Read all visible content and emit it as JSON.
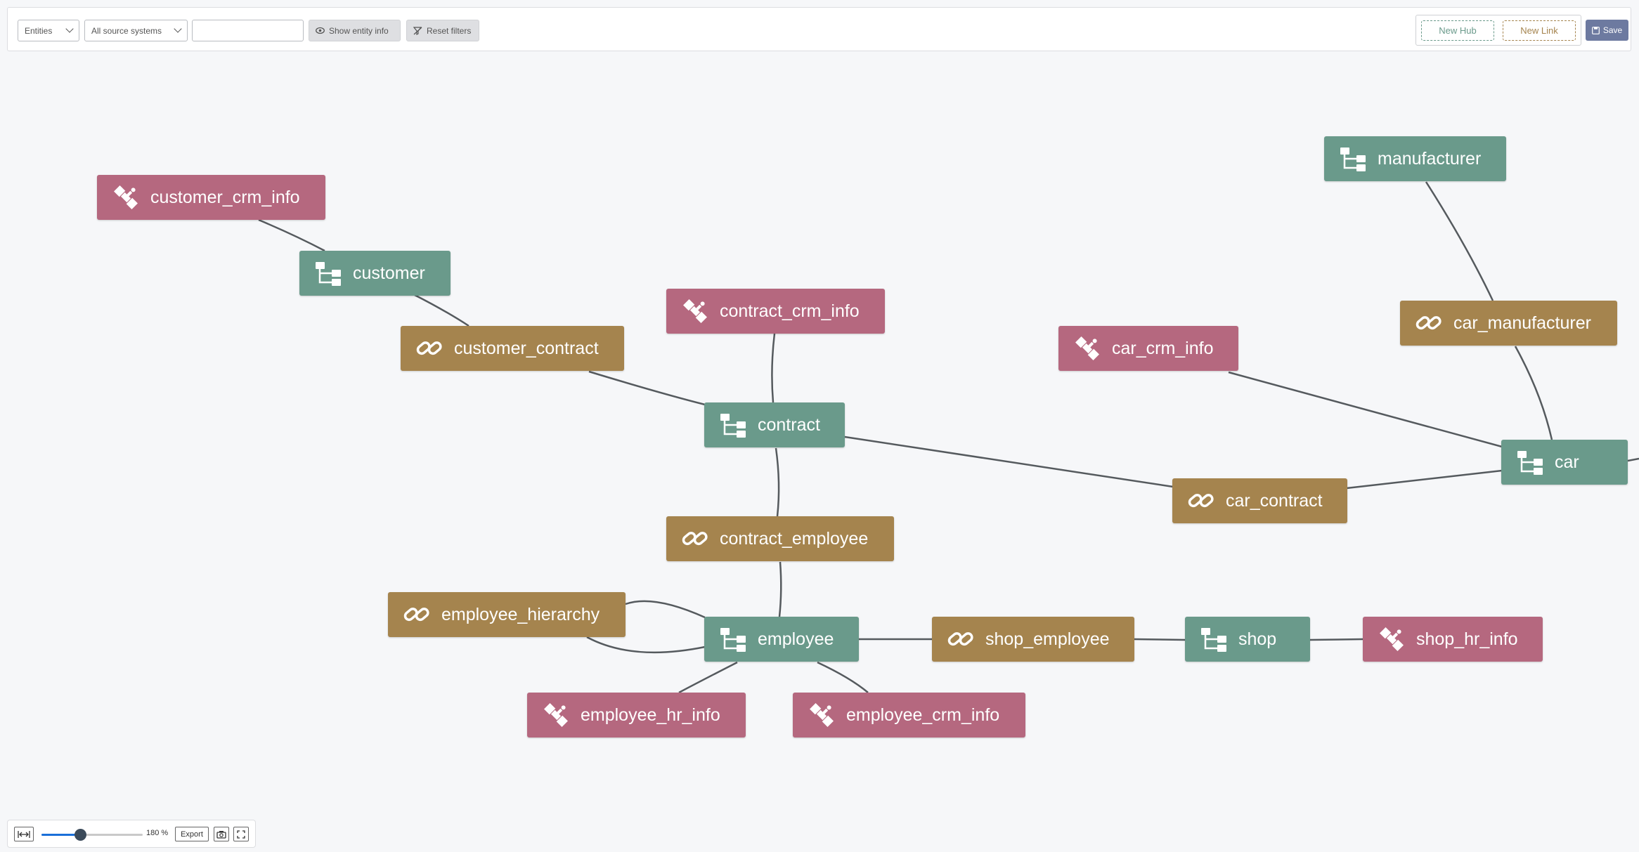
{
  "toolbar": {
    "entities_select": "Entities",
    "source_select": "All source systems",
    "search_value": "",
    "show_info_label": "Show entity info",
    "reset_label": "Reset filters",
    "new_hub_label": "New Hub",
    "new_link_label": "New Link",
    "save_label": "Save"
  },
  "colors": {
    "hub": "#6a9a8b",
    "link": "#a5844e",
    "satellite": "#b5687f",
    "edge": "#555a5e"
  },
  "diagram": {
    "nodes": [
      {
        "id": "customer_crm_info",
        "type": "satellite",
        "label": "customer_crm_info"
      },
      {
        "id": "customer",
        "type": "hub",
        "label": "customer"
      },
      {
        "id": "customer_contract",
        "type": "link",
        "label": "customer_contract"
      },
      {
        "id": "contract_crm_info",
        "type": "satellite",
        "label": "contract_crm_info"
      },
      {
        "id": "contract",
        "type": "hub",
        "label": "contract"
      },
      {
        "id": "contract_employee",
        "type": "link",
        "label": "contract_employee"
      },
      {
        "id": "employee_hierarchy",
        "type": "link",
        "label": "employee_hierarchy"
      },
      {
        "id": "employee",
        "type": "hub",
        "label": "employee"
      },
      {
        "id": "employee_hr_info",
        "type": "satellite",
        "label": "employee_hr_info"
      },
      {
        "id": "employee_crm_info",
        "type": "satellite",
        "label": "employee_crm_info"
      },
      {
        "id": "shop_employee",
        "type": "link",
        "label": "shop_employee"
      },
      {
        "id": "shop",
        "type": "hub",
        "label": "shop"
      },
      {
        "id": "shop_hr_info",
        "type": "satellite",
        "label": "shop_hr_info"
      },
      {
        "id": "car_crm_info",
        "type": "satellite",
        "label": "car_crm_info"
      },
      {
        "id": "car_contract",
        "type": "link",
        "label": "car_contract"
      },
      {
        "id": "manufacturer",
        "type": "hub",
        "label": "manufacturer"
      },
      {
        "id": "car_manufacturer",
        "type": "link",
        "label": "car_manufacturer"
      },
      {
        "id": "car",
        "type": "hub",
        "label": "car"
      }
    ],
    "edges": [
      [
        "customer_crm_info",
        "customer"
      ],
      [
        "customer",
        "customer_contract"
      ],
      [
        "customer_contract",
        "contract"
      ],
      [
        "contract_crm_info",
        "contract"
      ],
      [
        "contract",
        "contract_employee"
      ],
      [
        "contract",
        "car_contract"
      ],
      [
        "contract_employee",
        "employee"
      ],
      [
        "employee_hierarchy",
        "employee"
      ],
      [
        "employee_hierarchy",
        "employee"
      ],
      [
        "employee",
        "employee_hr_info"
      ],
      [
        "employee",
        "employee_crm_info"
      ],
      [
        "employee",
        "shop_employee"
      ],
      [
        "shop_employee",
        "shop"
      ],
      [
        "shop",
        "shop_hr_info"
      ],
      [
        "car_crm_info",
        "car"
      ],
      [
        "car_contract",
        "car"
      ],
      [
        "manufacturer",
        "car_manufacturer"
      ],
      [
        "car_manufacturer",
        "car"
      ]
    ]
  },
  "zoom": {
    "value": 180,
    "unit": "%",
    "slider_fraction": 0.38,
    "export_label": "Export"
  }
}
